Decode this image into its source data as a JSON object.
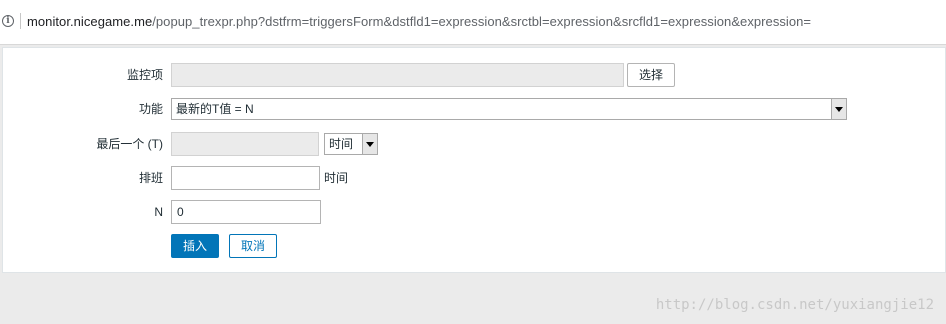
{
  "browser": {
    "url_host": "monitor.nicegame.me",
    "url_path": "/popup_trexpr.php?dstfrm=triggersForm&dstfld1=expression&srctbl=expression&srcfld1=expression&expression=",
    "info_icon": "info-icon"
  },
  "form": {
    "item": {
      "label": "监控项",
      "value": "",
      "select_button": "选择"
    },
    "function": {
      "label": "功能",
      "selected": "最新的T值 = N"
    },
    "last_t": {
      "label": "最后一个 (T)",
      "value": "",
      "unit_selected": "时间"
    },
    "shift": {
      "label": "排班",
      "value": "",
      "suffix": "时间"
    },
    "n": {
      "label": "N",
      "value": "0"
    },
    "buttons": {
      "insert": "插入",
      "cancel": "取消"
    }
  },
  "watermark": "http://blog.csdn.net/yuxiangjie12"
}
